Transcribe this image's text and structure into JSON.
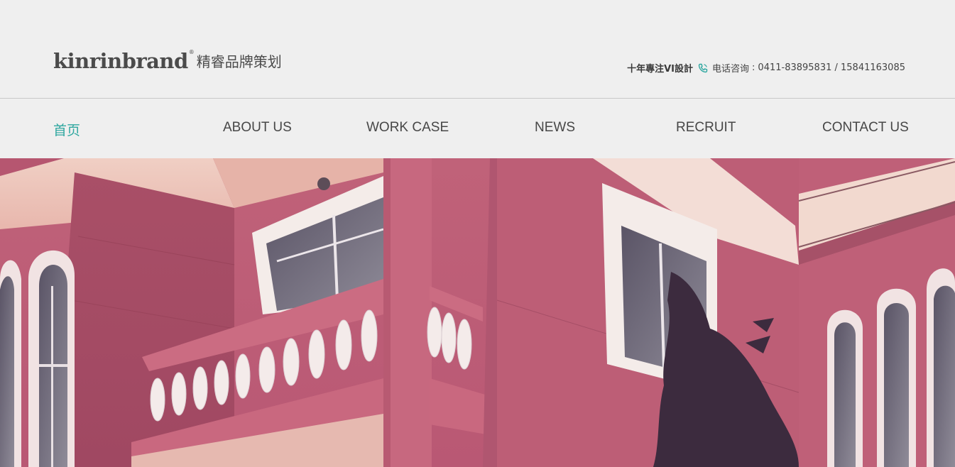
{
  "header": {
    "logo_en": "kinrinbrand",
    "logo_reg": "®",
    "logo_cn": "精睿品牌策划",
    "slogan": "十年專注VI設計",
    "phone_icon": "phone-icon",
    "tel_label": "电话咨询",
    "tel_sep": ":",
    "tel_numbers": "0411-83895831 / 15841163085"
  },
  "nav": {
    "items": [
      {
        "label": "首页",
        "active": true
      },
      {
        "label": "ABOUT US"
      },
      {
        "label": "WORK CASE"
      },
      {
        "label": "NEWS"
      },
      {
        "label": "RECRUIT"
      },
      {
        "label": "CONTACT US"
      }
    ]
  },
  "colors": {
    "accent": "#2fa7a0",
    "background": "#efefef",
    "text": "#474747"
  }
}
